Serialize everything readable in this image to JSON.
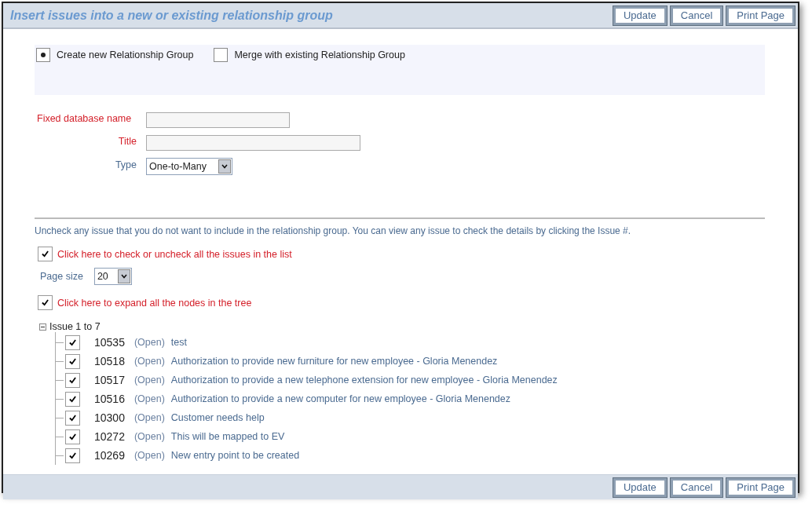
{
  "window": {
    "title": "Insert issues into a new or existing relationship group"
  },
  "top_buttons": [
    "Update",
    "Cancel",
    "Print Page"
  ],
  "mode_options": [
    {
      "label": "Create new Relationship Group",
      "selected": true
    },
    {
      "label": "Merge with existing Relationship Group",
      "selected": false
    }
  ],
  "form": {
    "fields": [
      {
        "label": "Fixed database name",
        "kind": "text",
        "required": true
      },
      {
        "label": "Title",
        "kind": "text",
        "required": true
      },
      {
        "label": "Type",
        "kind": "select",
        "required": false,
        "value": "One-to-Many"
      }
    ]
  },
  "instructions": "Uncheck any issue that you do not want to include in the relationship group. You can view any issue to check the details by clicking the Issue #.",
  "check_all": {
    "label": "Click here to check or uncheck all the issues in the list",
    "checked": true
  },
  "page_size": {
    "label": "Page size",
    "value": "20"
  },
  "expand_all": {
    "label": "Click here to expand all the nodes in the tree",
    "checked": true
  },
  "tree": {
    "label": "Issue 1 to 7",
    "expanded": true,
    "children": [
      {
        "number": "10535",
        "status": "(Open)",
        "summary": "test",
        "checked": true
      },
      {
        "number": "10518",
        "status": "(Open)",
        "summary": "Authorization to provide new furniture for new employee - Gloria Menendez",
        "checked": true
      },
      {
        "number": "10517",
        "status": "(Open)",
        "summary": "Authorization to provide a new telephone extension for new employee - Gloria Menendez",
        "checked": true
      },
      {
        "number": "10516",
        "status": "(Open)",
        "summary": "Authorization to provide a new computer for new employee - Gloria Menendez",
        "checked": true
      },
      {
        "number": "10300",
        "status": "(Open)",
        "summary": "Customer needs help",
        "checked": true
      },
      {
        "number": "10272",
        "status": "(Open)",
        "summary": "This will be mapped to EV",
        "checked": true
      },
      {
        "number": "10269",
        "status": "(Open)",
        "summary": "New entry point to be created",
        "checked": true
      }
    ]
  },
  "bottom_buttons": [
    "Update",
    "Cancel",
    "Print Page"
  ]
}
